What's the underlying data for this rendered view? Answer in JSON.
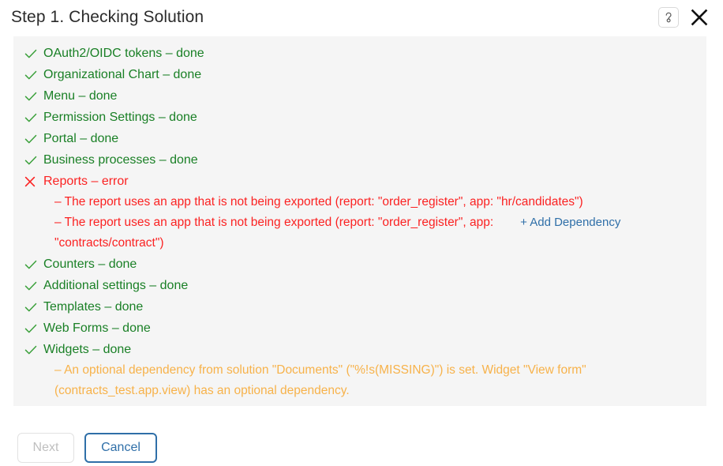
{
  "header": {
    "title": "Step 1. Checking Solution",
    "help_icon": "question-mark-icon",
    "close_icon": "close-icon"
  },
  "results": [
    {
      "status": "ok",
      "icon": "check-icon",
      "label": "OAuth2/OIDC tokens – done",
      "details": []
    },
    {
      "status": "ok",
      "icon": "check-icon",
      "label": "Organizational Chart – done",
      "details": []
    },
    {
      "status": "ok",
      "icon": "check-icon",
      "label": "Menu – done",
      "details": []
    },
    {
      "status": "ok",
      "icon": "check-icon",
      "label": "Permission Settings – done",
      "details": []
    },
    {
      "status": "ok",
      "icon": "check-icon",
      "label": "Portal – done",
      "details": []
    },
    {
      "status": "ok",
      "icon": "check-icon",
      "label": "Business processes – done",
      "details": []
    },
    {
      "status": "error",
      "icon": "cross-icon",
      "label": "Reports – error",
      "details": [
        {
          "kind": "error",
          "text": "– The report uses an app that is not being exported (report: \"order_register\", app: \"hr/candidates\")"
        },
        {
          "kind": "error",
          "text": "– The report uses an app that is not being exported (report: \"order_register\", app: \"contracts/contract\")",
          "action": "+ Add Dependency"
        }
      ]
    },
    {
      "status": "ok",
      "icon": "check-icon",
      "label": "Counters – done",
      "details": []
    },
    {
      "status": "ok",
      "icon": "check-icon",
      "label": "Additional settings – done",
      "details": []
    },
    {
      "status": "ok",
      "icon": "check-icon",
      "label": "Templates – done",
      "details": []
    },
    {
      "status": "ok",
      "icon": "check-icon",
      "label": "Web Forms – done",
      "details": []
    },
    {
      "status": "ok",
      "icon": "check-icon",
      "label": "Widgets – done",
      "details": [
        {
          "kind": "warn",
          "text": "– An optional dependency from solution \"Documents\" (\"%!s(MISSING)\") is set. Widget \"View form\" (contracts_test.app.view) has an optional dependency."
        }
      ]
    }
  ],
  "error_detail_lines": {
    "line1": "– The report uses an app that is not being exported (report: \"order_register\", app: \"hr/candidates\")",
    "line2_part1": "– The report uses an app that is not being exported (report: \"order_register\", app:",
    "line2_part2": "\"contracts/contract\")",
    "add_dependency": "+ Add Dependency"
  },
  "warn_detail_lines": {
    "line1": "– An optional dependency from solution \"Documents\" (\"%!s(MISSING)\") is set. Widget \"View form\"",
    "line2": "(contracts_test.app.view) has an optional dependency."
  },
  "footer": {
    "next_label": "Next",
    "cancel_label": "Cancel"
  },
  "colors": {
    "ok": "#1a8026",
    "error": "#fb2222",
    "warn": "#f7b24a",
    "link": "#2f6fa8",
    "panel_bg": "#f5f5f5"
  }
}
